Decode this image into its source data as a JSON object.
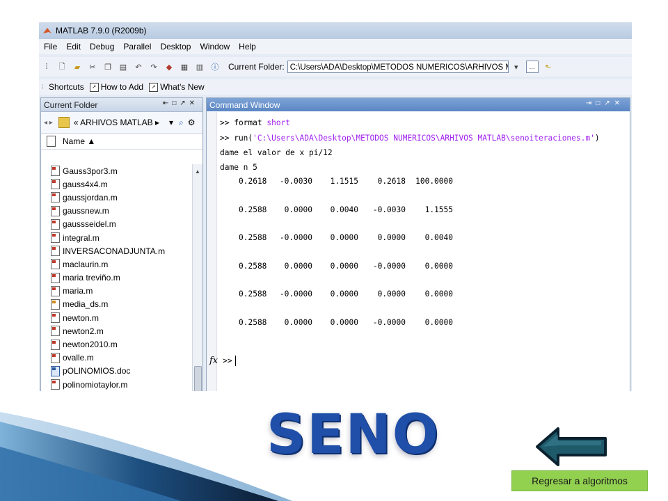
{
  "window": {
    "title": "MATLAB 7.9.0 (R2009b)"
  },
  "menu": [
    "File",
    "Edit",
    "Debug",
    "Parallel",
    "Desktop",
    "Window",
    "Help"
  ],
  "toolbar": {
    "current_folder_label": "Current Folder:",
    "current_folder_path": "C:\\Users\\ADA\\Desktop\\METODOS NUMERICOS\\ARHIVOS MATLAB",
    "browse_button": "..."
  },
  "shortcuts_bar": {
    "shortcuts": "Shortcuts",
    "how_to_add": "How to Add",
    "whats_new": "What's New"
  },
  "current_folder_panel": {
    "title": "Current Folder",
    "address": "« ARHIVOS MATLAB ▸",
    "column_header": "Name ▲",
    "files": [
      {
        "name": "Gauss3por3.m",
        "type": "m"
      },
      {
        "name": "gauss4x4.m",
        "type": "m"
      },
      {
        "name": "gaussjordan.m",
        "type": "m"
      },
      {
        "name": "gaussnew.m",
        "type": "m"
      },
      {
        "name": "gaussseidel.m",
        "type": "m"
      },
      {
        "name": "integral.m",
        "type": "m"
      },
      {
        "name": "INVERSACONADJUNTA.m",
        "type": "m"
      },
      {
        "name": "maclaurin.m",
        "type": "m"
      },
      {
        "name": "maria treviño.m",
        "type": "m"
      },
      {
        "name": "maria.m",
        "type": "m"
      },
      {
        "name": "media_ds.m",
        "type": "fx"
      },
      {
        "name": "newton.m",
        "type": "m"
      },
      {
        "name": "newton2.m",
        "type": "m"
      },
      {
        "name": "newton2010.m",
        "type": "m"
      },
      {
        "name": "ovalle.m",
        "type": "m"
      },
      {
        "name": "pOLINOMIOS.doc",
        "type": "doc"
      },
      {
        "name": "polinomiotaylor.m",
        "type": "m"
      }
    ]
  },
  "command_window": {
    "title": "Command Window",
    "line1_prompt": ">> format ",
    "line1_arg": "short",
    "line2_prompt": ">> run(",
    "line2_arg": "'C:\\Users\\ADA\\Desktop\\METODOS NUMERICOS\\ARHIVOS MATLAB\\senoiteraciones.m'",
    "line2_close": ")",
    "line3": "dame el valor de x pi/12",
    "line4": "dame n 5",
    "rows": [
      [
        "0.2618",
        "-0.0030",
        "1.1515",
        "0.2618",
        "100.0000"
      ],
      [
        "0.2588",
        "0.0000",
        "0.0040",
        "-0.0030",
        "1.1555"
      ],
      [
        "0.2588",
        "-0.0000",
        "0.0000",
        "0.0000",
        "0.0040"
      ],
      [
        "0.2588",
        "0.0000",
        "0.0000",
        "-0.0000",
        "0.0000"
      ],
      [
        "0.2588",
        "-0.0000",
        "0.0000",
        "0.0000",
        "0.0000"
      ],
      [
        "0.2588",
        "0.0000",
        "0.0000",
        "-0.0000",
        "0.0000"
      ]
    ],
    "fx_label": "fx",
    "prompt": ">>"
  },
  "slide": {
    "title": "SENO",
    "back_link": "Regresar a algoritmos"
  },
  "colors": {
    "title_blue": "#1f4fa8",
    "link_green": "#92d050",
    "arrow_teal": "#1f5a6a",
    "matlab_string": "#a020f0"
  }
}
